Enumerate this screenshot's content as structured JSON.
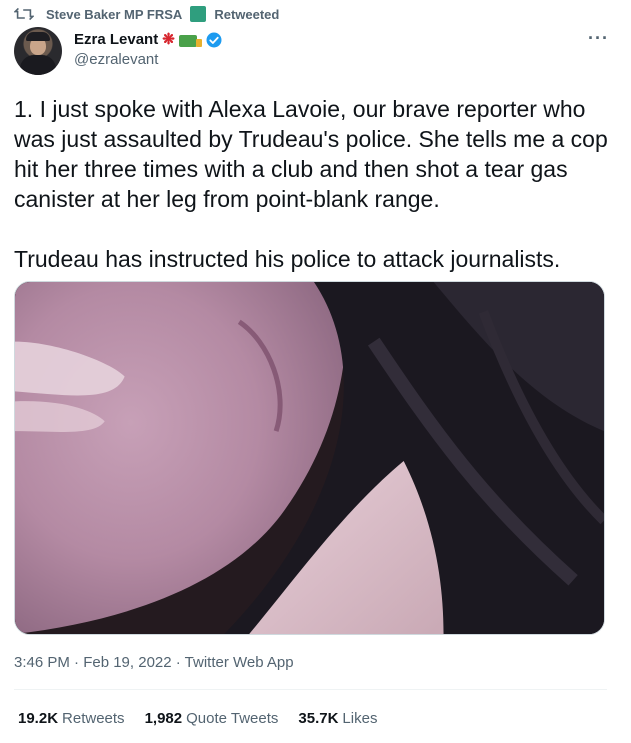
{
  "retweet": {
    "icon": "retweet-icon",
    "user": "Steve Baker MP FRSA",
    "badge_icon": "statue-of-liberty-icon",
    "label": "Retweeted"
  },
  "author": {
    "name": "Ezra Levant",
    "emojis": [
      "maple-leaf-icon",
      "truck-icon"
    ],
    "handle": "@ezralevant",
    "verified_icon": "verified-badge-icon"
  },
  "more_label": "···",
  "tweet": {
    "text": "1. I just spoke with Alexa Lavoie, our brave reporter who was just assaulted by Trudeau's police. She tells me a cop hit her three times with a club and then shot a tear gas canister at her leg from point-blank range.\n\nTrudeau has instructed his police to attack journalists."
  },
  "meta": {
    "timestamp": "3:46 PM · Feb 19, 2022 · Twitter Web App"
  },
  "stats": {
    "retweets_count": "19.2K",
    "retweets_label": "Retweets",
    "quotes_count": "1,982",
    "quotes_label": "Quote Tweets",
    "likes_count": "35.7K",
    "likes_label": "Likes"
  },
  "colors": {
    "text": "#0f1419",
    "secondary": "#536471",
    "verified": "#1d9bf0",
    "divider": "#eff3f4"
  }
}
